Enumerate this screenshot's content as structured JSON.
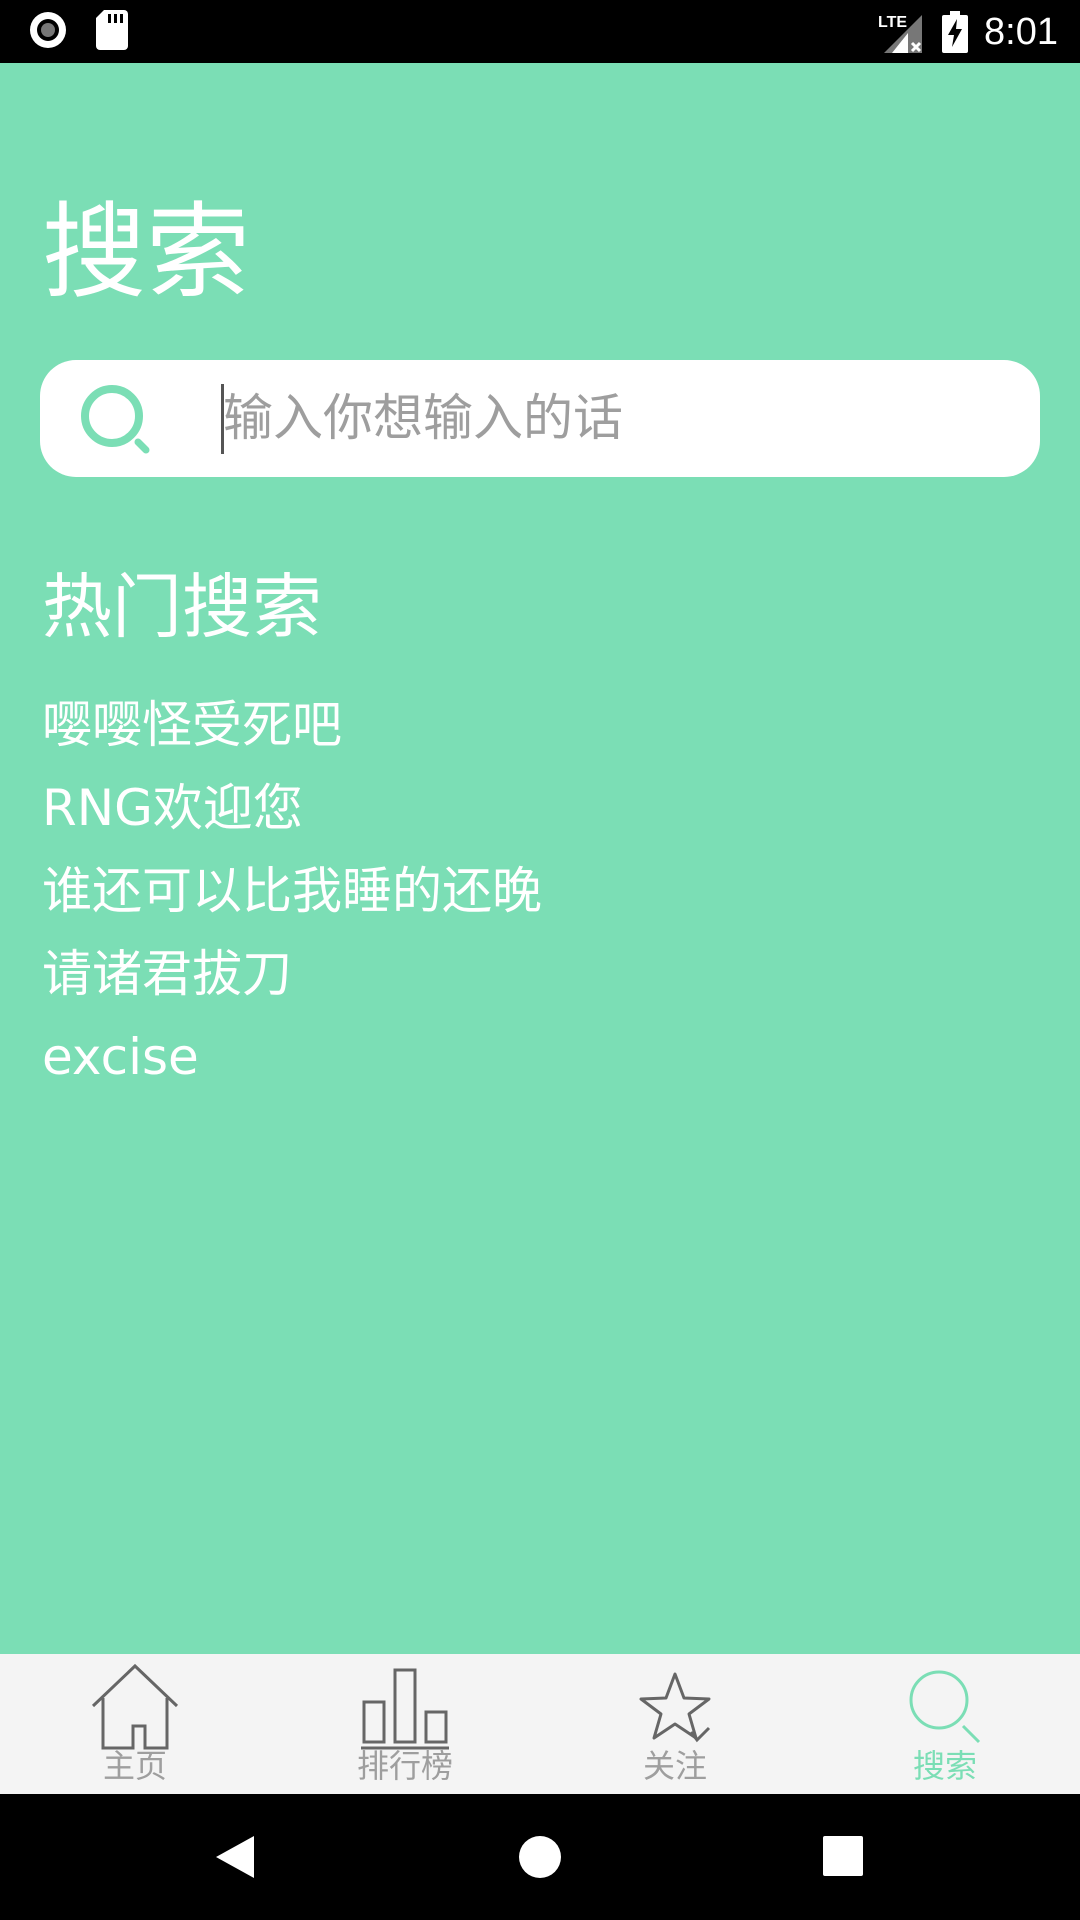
{
  "status_bar": {
    "time": "8:01",
    "network": "LTE"
  },
  "page": {
    "title": "搜索"
  },
  "search": {
    "placeholder": "输入你想输入的话",
    "value": ""
  },
  "hot_search": {
    "title": "热门搜索",
    "items": [
      "嘤嘤怪受死吧",
      "RNG欢迎您",
      "谁还可以比我睡的还晚",
      "请诸君拔刀",
      "excise"
    ]
  },
  "bottom_nav": {
    "items": [
      {
        "label": "主页",
        "icon": "home-icon",
        "active": false
      },
      {
        "label": "排行榜",
        "icon": "bar-chart-icon",
        "active": false
      },
      {
        "label": "关注",
        "icon": "star-check-icon",
        "active": false
      },
      {
        "label": "搜索",
        "icon": "search-icon",
        "active": true
      }
    ]
  },
  "colors": {
    "background": "#7bdeb5",
    "accent": "#7bdeb5",
    "nav_inactive": "#9e9e9e",
    "nav_background": "#f4f4f4"
  }
}
